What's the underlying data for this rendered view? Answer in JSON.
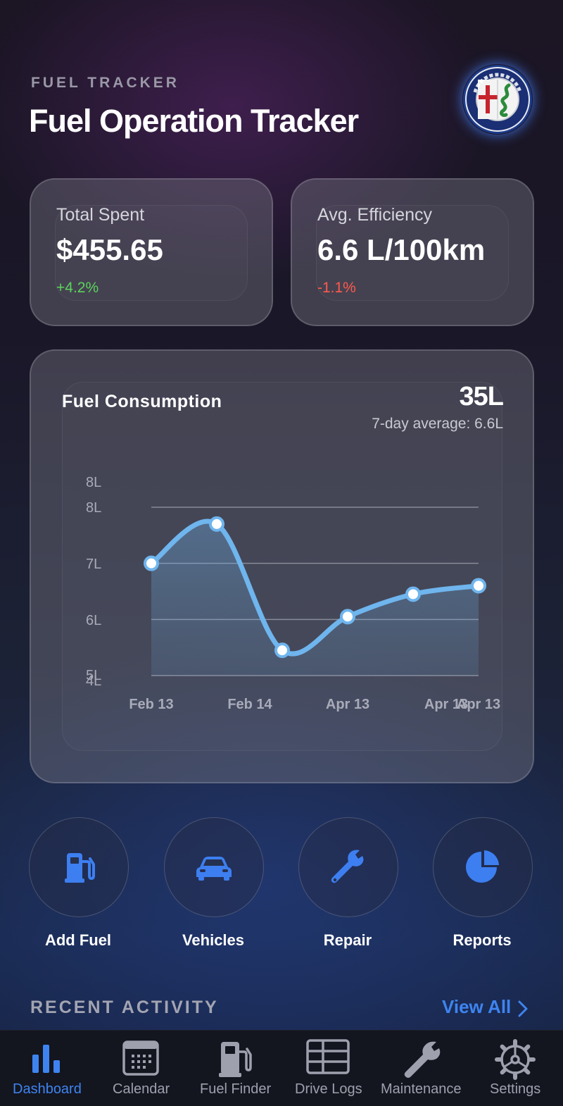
{
  "header": {
    "eyebrow": "FUEL TRACKER",
    "title": "Fuel Operation Tracker",
    "logo_icon": "alfa-romeo-logo"
  },
  "stats": [
    {
      "label": "Total Spent",
      "value": "$455.65",
      "change": "+4.2%",
      "change_color": "#5cd35c"
    },
    {
      "label": "Avg. Efficiency",
      "value": "6.6 L/100km",
      "change": "-1.1%",
      "change_color": "#ff5a4e"
    }
  ],
  "chart": {
    "title": "Fuel Consumption",
    "value": "35L",
    "subtitle": "7-day average: 6.6L"
  },
  "chart_data": {
    "type": "line",
    "title": "Fuel Consumption",
    "xlabel": "",
    "ylabel": "",
    "y_tick_labels": [
      "8L",
      "8L",
      "7L",
      "6L",
      "5L",
      "4L"
    ],
    "x_tick_labels": [
      "Feb 13",
      "Feb 14",
      "Apr 13",
      "Apr 13",
      "Apr 13"
    ],
    "ylim": [
      5,
      8
    ],
    "grid": true,
    "series": [
      {
        "values": [
          7.0,
          7.7,
          5.45,
          6.05,
          6.45,
          6.6
        ],
        "color": "#6fb5ee"
      }
    ]
  },
  "actions": [
    {
      "label": "Add Fuel",
      "icon": "fuel-pump-icon"
    },
    {
      "label": "Vehicles",
      "icon": "car-icon"
    },
    {
      "label": "Repair",
      "icon": "wrench-icon"
    },
    {
      "label": "Reports",
      "icon": "pie-chart-icon"
    }
  ],
  "recent": {
    "title": "RECENT ACTIVITY",
    "view_all": "View All"
  },
  "tabs": [
    {
      "label": "Dashboard",
      "icon": "bar-chart-icon",
      "active": true
    },
    {
      "label": "Calendar",
      "icon": "calendar-icon",
      "active": false
    },
    {
      "label": "Fuel Finder",
      "icon": "gas-pump-icon",
      "active": false
    },
    {
      "label": "Drive Logs",
      "icon": "table-icon",
      "active": false
    },
    {
      "label": "Maintenance",
      "icon": "wrench-icon",
      "active": false
    },
    {
      "label": "Settings",
      "icon": "gear-icon",
      "active": false
    }
  ],
  "colors": {
    "accent": "#3e84f0",
    "line": "#6fb5ee",
    "inactive": "#9ea1ad"
  }
}
